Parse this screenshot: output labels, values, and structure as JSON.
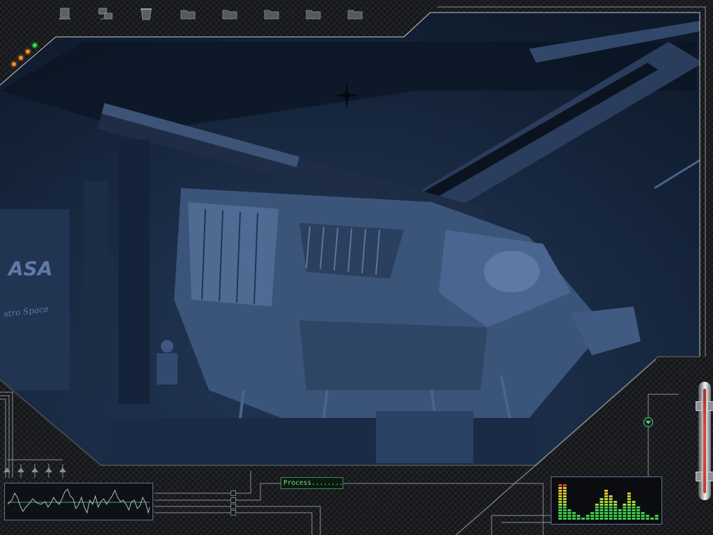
{
  "desktop": {
    "toolbar_icons": [
      "computer-icon",
      "network-icon",
      "recycle-bin-icon",
      "folder-icon",
      "folder-icon",
      "folder-icon",
      "folder-icon",
      "folder-icon"
    ],
    "status_leds": [
      "#ff8a1f",
      "#ff8a1f",
      "#ff8a1f",
      "#33e04a"
    ]
  },
  "photo": {
    "signage_main": "ASA",
    "signage_sub": "stro  Space"
  },
  "widgets": {
    "process_status": "Process.............OK",
    "equalizer_levels": [
      0.92,
      0.92,
      0.3,
      0.22,
      0.12,
      0.05,
      0.12,
      0.2,
      0.45,
      0.55,
      0.75,
      0.62,
      0.48,
      0.3,
      0.4,
      0.7,
      0.52,
      0.35,
      0.22,
      0.12,
      0.05,
      0.15
    ],
    "thermometer_level": 0.88
  },
  "colors": {
    "accent_green": "#4fcf7d",
    "frame_line": "#c8ccd2",
    "panel_border": "#6b6f9e"
  }
}
